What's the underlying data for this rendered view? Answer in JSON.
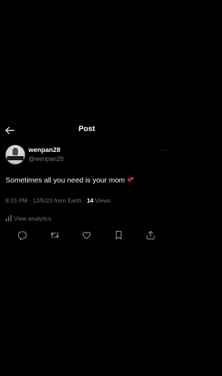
{
  "header": {
    "title": "Post",
    "back_icon": "arrow-left-icon"
  },
  "tweet": {
    "author": {
      "name": "wenpan28",
      "handle": "@wenpan28",
      "avatar_icon": "avatar"
    },
    "more_icon": "more-horizontal-icon",
    "text": "Sometimes all you need is your mom",
    "emoji": "two-hearts-icon",
    "meta": {
      "time": "8:15 PM",
      "separator": " · ",
      "date": "12/5/23",
      "location": " from Earth",
      "views_count": "14",
      "views_label": " Views"
    },
    "analytics_label": "View analytics",
    "actions": [
      {
        "name": "reply-icon"
      },
      {
        "name": "repost-icon"
      },
      {
        "name": "like-icon"
      },
      {
        "name": "bookmark-icon"
      },
      {
        "name": "share-icon"
      }
    ]
  },
  "colors": {
    "background": "#000000",
    "text_primary": "#ffffff",
    "text_secondary": "#71767b",
    "emoji_pink": "#e0245e"
  }
}
